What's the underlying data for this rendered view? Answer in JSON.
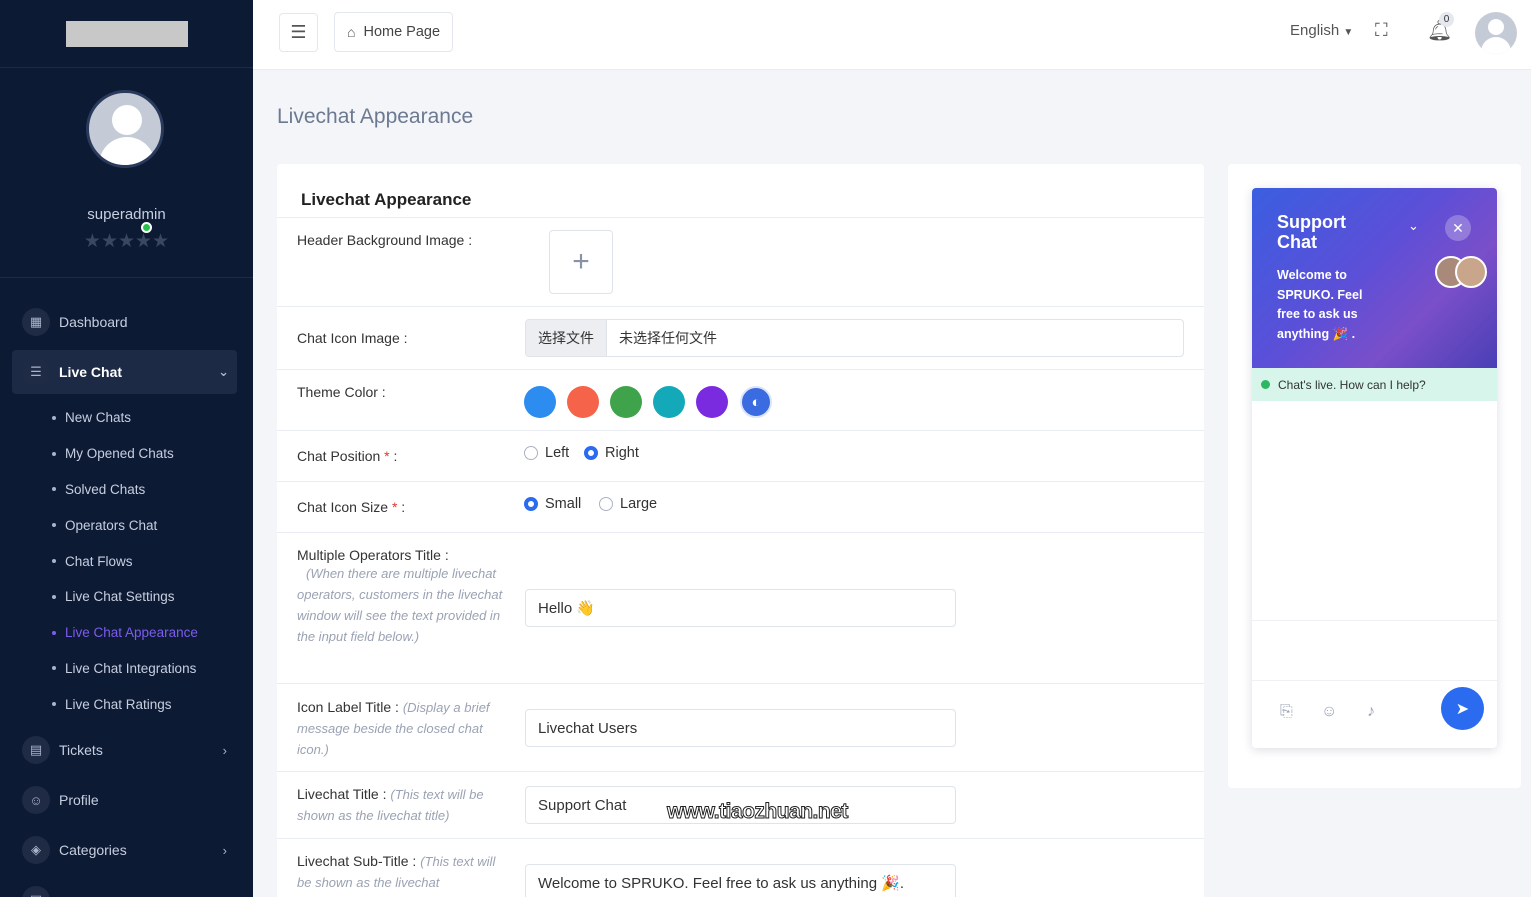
{
  "sidebar": {
    "user_name": "superadmin",
    "stars": "★★★★★",
    "nav": {
      "dashboard": "Dashboard",
      "live_chat": "Live Chat",
      "tickets": "Tickets",
      "profile": "Profile",
      "categories": "Categories"
    },
    "live_chat_sub": [
      "New Chats",
      "My Opened Chats",
      "Solved Chats",
      "Operators Chat",
      "Chat Flows",
      "Live Chat Settings",
      "Live Chat Appearance",
      "Live Chat Integrations",
      "Live Chat Ratings"
    ]
  },
  "header": {
    "home": "Home Page",
    "language": "English",
    "notification_count": "0"
  },
  "page": {
    "title": "Livechat Appearance",
    "card_title": "Livechat Appearance"
  },
  "form": {
    "header_bg_label": "Header Background Image :",
    "chat_icon_label": "Chat Icon Image :",
    "file_button": "选择文件",
    "file_status": "未选择任何文件",
    "theme_color_label": "Theme Color :",
    "theme_colors": [
      "#2d8cf0",
      "#f5634a",
      "#3ea34a",
      "#13a9b8",
      "#7a2be0"
    ],
    "chat_position_label": "Chat Position",
    "position_left": "Left",
    "position_right": "Right",
    "chat_icon_size_label": "Chat Icon Size",
    "size_small": "Small",
    "size_large": "Large",
    "multi_ops_label": "Multiple Operators Title :",
    "multi_ops_hint": "(When there are multiple livechat operators, customers in the livechat window will see the text provided in the input field below.)",
    "multi_ops_value": "Hello 👋",
    "icon_label_title": "Icon Label Title :",
    "icon_label_hint": "(Display a brief message beside the closed chat icon.)",
    "icon_label_value": "Livechat Users",
    "livechat_title_label": "Livechat Title :",
    "livechat_title_hint": "(This text will be shown as the livechat title)",
    "livechat_title_value": "Support Chat",
    "livechat_subtitle_label": "Livechat Sub-Title :",
    "livechat_subtitle_hint": "(This text will be shown as the livechat",
    "livechat_subtitle_value": "Welcome to SPRUKO. Feel free to ask us anything 🎉."
  },
  "preview": {
    "title": "Support Chat",
    "subtitle": "Welcome to SPRUKO. Feel free to ask us anything 🎉 .",
    "status": "Chat's live. How can I help?"
  },
  "watermark": "www.tiaozhuan.net"
}
